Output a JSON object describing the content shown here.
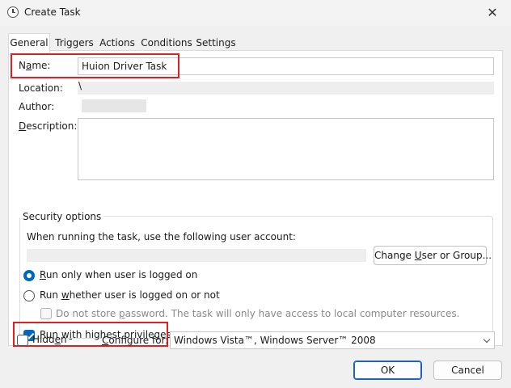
{
  "window": {
    "title": "Create Task",
    "close_symbol": "✕"
  },
  "tabs": [
    {
      "label": "General",
      "active": true
    },
    {
      "label": "Triggers"
    },
    {
      "label": "Actions"
    },
    {
      "label": "Conditions"
    },
    {
      "label": "Settings"
    }
  ],
  "general": {
    "name_label_underlined": "a",
    "name_label_rest_pre": "N",
    "name_label_rest_post": "me:",
    "name_value": "Huion Driver Task",
    "location_label": "Location:",
    "location_value": "\\",
    "author_label": "Author:",
    "description_label_pre": "",
    "description_label_underlined": "D",
    "description_label_post": "escription:",
    "description_value": ""
  },
  "security": {
    "legend": "Security options",
    "account_prompt": "When running the task, use the following user account:",
    "change_button_pre": "Change ",
    "change_button_underlined": "U",
    "change_button_post": "ser or Group...",
    "run_logged_on_underlined": "R",
    "run_logged_on_post": "un only when user is logged on",
    "run_whether_pre": "Run ",
    "run_whether_underlined": "w",
    "run_whether_post": "hether user is logged on or not",
    "no_store_pre": "Do not store ",
    "no_store_underlined": "p",
    "no_store_post": "assword.  The task will only have access to local computer resources.",
    "highest_pre": "Run w",
    "highest_underlined": "i",
    "highest_post": "th highest privileges",
    "run_logged_on_selected": true,
    "run_highest_checked": true
  },
  "footer": {
    "hidden_pre": "Hidd",
    "hidden_underlined": "e",
    "hidden_post": "n",
    "configure_underlined": "C",
    "configure_post": "onfigure for:",
    "configure_value": "Windows Vista™, Windows Server™ 2008",
    "ok_label": "OK",
    "cancel_label": "Cancel"
  },
  "colors": {
    "accent": "#0067c0",
    "highlight_box": "#e02020",
    "panel_bg": "#ffffff",
    "dialog_bg": "#f0f0f0"
  }
}
